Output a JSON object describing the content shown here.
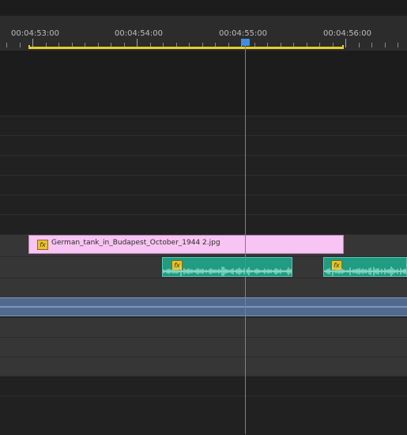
{
  "timeline": {
    "timecodes": [
      "00:04:53:00",
      "00:04:54:00",
      "00:04:55:00",
      "00:04:56:00"
    ],
    "playhead_timecode": "00:04:55:00"
  },
  "clips": {
    "image": {
      "label": "German_tank_in_Budapest_October_1944 2.jpg",
      "fx": "fx"
    },
    "audio_1": {
      "fx": "fx"
    },
    "audio_2": {
      "fx": "fx"
    }
  },
  "colors": {
    "playhead": "#3f8fe0",
    "work_area": "#e3cf2c",
    "image_clip": "#f8c4f3",
    "audio_clip": "#1f9c81",
    "selected_track": "#52698e",
    "fx_badge": "#e8c22b"
  }
}
